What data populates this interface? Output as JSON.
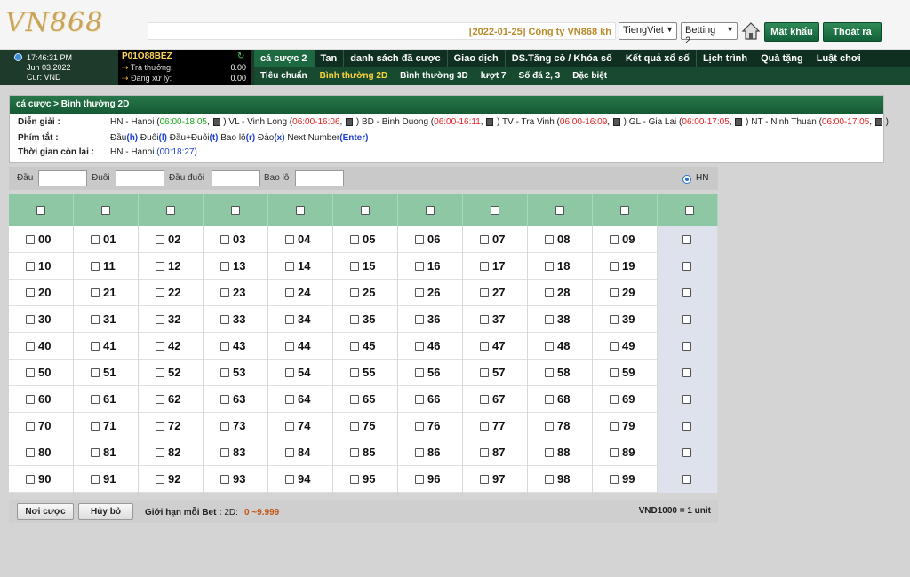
{
  "header": {
    "logo": "VN868",
    "marquee": "[2022-01-25] Công ty VN868 kh",
    "language": "TiengViet",
    "mode": "Betting 2",
    "password_label": "Mật khẩu",
    "logout_label": "Thoát ra"
  },
  "info": {
    "time": "17:46:31 PM",
    "date": "Jun 03,2022",
    "currency": "Cur: VND",
    "user_id": "P01O88BEZ",
    "payout_label": "Trả thưởng:",
    "payout_value": "0.00",
    "pending_label": "Đang xử lý:",
    "pending_value": "0.00"
  },
  "nav": {
    "main": [
      "cá cược 2",
      "Tan",
      "danh sách đã cược",
      "Giao dịch",
      "DS.Tăng cò / Khóa số",
      "Kết quả xổ số",
      "Lịch trình",
      "Quà tặng",
      "Luật chơi"
    ],
    "sub": [
      "Tiêu chuẩn",
      "Bình thường 2D",
      "Bình thường 3D",
      "lượt 7",
      "Số đá 2, 3",
      "Đặc biệt"
    ]
  },
  "panel": {
    "breadcrumb": "cá cược > Bình thường 2D",
    "desc_label": "Diễn giải :",
    "hotkey_label": "Phím tắt :",
    "remaining_label": "Thời gian còn lại :",
    "remaining_region": "HN - Hanoi",
    "remaining_time": "(00:18:27)",
    "regions": [
      {
        "name": "HN - Hanoi",
        "time": "06:00-18:05"
      },
      {
        "name": "VL - Vinh Long",
        "time": "06:00-16:06"
      },
      {
        "name": "BD - Binh Duong",
        "time": "06:00-16:11"
      },
      {
        "name": "TV - Tra Vinh",
        "time": "06:00-16:09"
      },
      {
        "name": "GL - Gia Lai",
        "time": "06:00-17:05"
      },
      {
        "name": "NT - Ninh Thuan",
        "time": "06:00-17:05"
      }
    ],
    "hotkeys": [
      {
        "label": "Đầu",
        "key": "h"
      },
      {
        "label": "Đuôi",
        "key": "l"
      },
      {
        "label": "Đầu+Đuôi",
        "key": "t"
      },
      {
        "label": "Bao lô",
        "key": "r"
      },
      {
        "label": "Đảo",
        "key": "x"
      },
      {
        "label": "Next Number",
        "key": "Enter"
      }
    ]
  },
  "inputs": {
    "dau": "Đầu",
    "duoi": "Đuôi",
    "dau_duoi": "Đầu đuôi",
    "bao_lo": "Bao lô",
    "radio": "HN"
  },
  "grid": {
    "numbers": [
      [
        "00",
        "01",
        "02",
        "03",
        "04",
        "05",
        "06",
        "07",
        "08",
        "09"
      ],
      [
        "10",
        "11",
        "12",
        "13",
        "14",
        "15",
        "16",
        "17",
        "18",
        "19"
      ],
      [
        "20",
        "21",
        "22",
        "23",
        "24",
        "25",
        "26",
        "27",
        "28",
        "29"
      ],
      [
        "30",
        "31",
        "32",
        "33",
        "34",
        "35",
        "36",
        "37",
        "38",
        "39"
      ],
      [
        "40",
        "41",
        "42",
        "43",
        "44",
        "45",
        "46",
        "47",
        "48",
        "49"
      ],
      [
        "50",
        "51",
        "52",
        "53",
        "54",
        "55",
        "56",
        "57",
        "58",
        "59"
      ],
      [
        "60",
        "61",
        "62",
        "63",
        "64",
        "65",
        "66",
        "67",
        "68",
        "69"
      ],
      [
        "70",
        "71",
        "72",
        "73",
        "74",
        "75",
        "76",
        "77",
        "78",
        "79"
      ],
      [
        "80",
        "81",
        "82",
        "83",
        "84",
        "85",
        "86",
        "87",
        "88",
        "89"
      ],
      [
        "90",
        "91",
        "92",
        "93",
        "94",
        "95",
        "96",
        "97",
        "98",
        "99"
      ]
    ]
  },
  "footer": {
    "place_bet": "Nơi cược",
    "cancel": "Hủy bỏ",
    "limit_label": "Giới hạn mỗi Bet :",
    "limit_type": "2D:",
    "limit_value": "0 ~9.999",
    "unit": "VND1000 = 1 unit"
  }
}
